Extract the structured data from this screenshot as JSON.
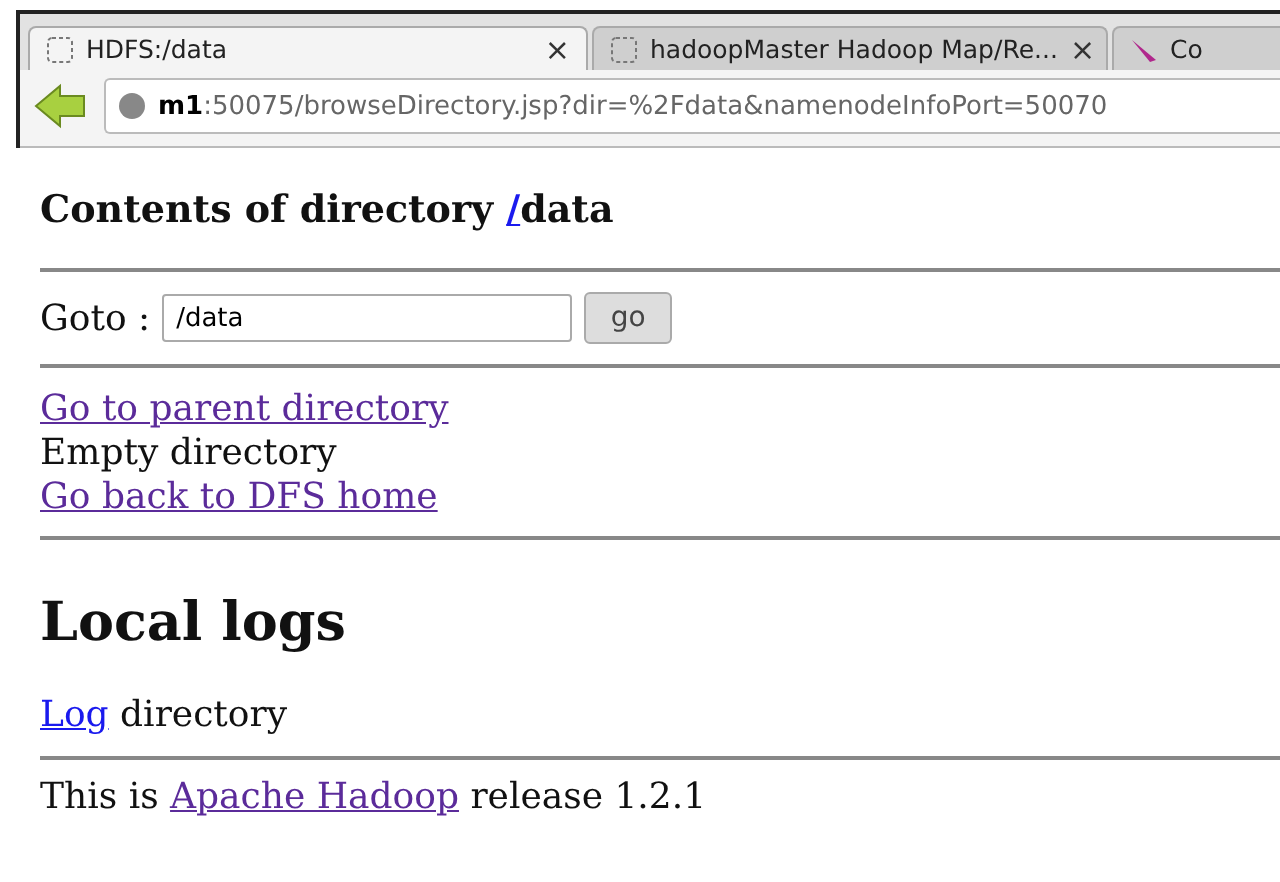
{
  "tabs": [
    {
      "title": "HDFS:/data",
      "selected": true,
      "close": "×",
      "kind": "blank"
    },
    {
      "title": "hadoopMaster Hadoop Map/Re...",
      "selected": false,
      "close": "×",
      "kind": "blank"
    },
    {
      "title": "Co",
      "selected": false,
      "kind": "feather"
    }
  ],
  "address": {
    "host": "m1",
    "rest": ":50075/browseDirectory.jsp?dir=%2Fdata&namenodeInfoPort=50070"
  },
  "heading": {
    "text": "Contents of directory ",
    "link": "/",
    "link_visited": false,
    "tail": "data"
  },
  "goto": {
    "label": "Goto :",
    "value": "/data",
    "button": "go"
  },
  "links": [
    {
      "kind": "link",
      "text": "Go to parent directory",
      "visited": true
    },
    {
      "kind": "text",
      "text": "Empty directory"
    },
    {
      "kind": "link",
      "text": "Go back to DFS home",
      "visited": true
    }
  ],
  "logs": {
    "title": "Local logs",
    "link": "Log",
    "link_visited": false,
    "text": " directory"
  },
  "footer": {
    "before": "This is ",
    "link": "Apache Hadoop",
    "link_visited": true,
    "after": " release 1.2.1"
  }
}
